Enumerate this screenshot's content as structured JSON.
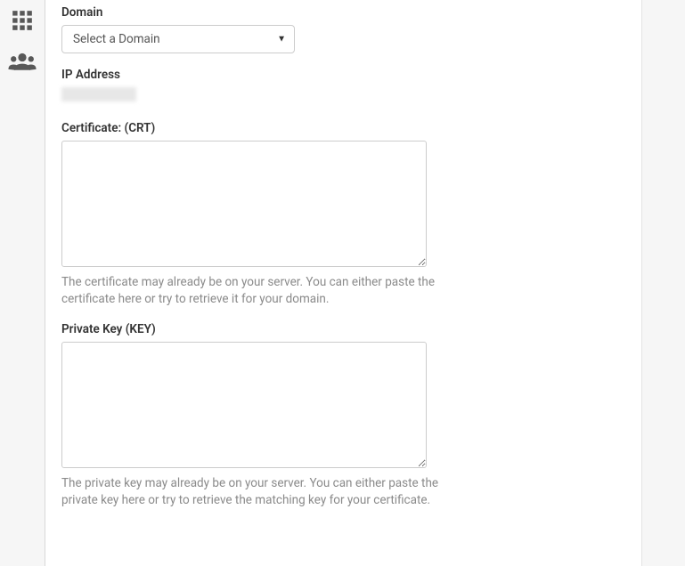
{
  "sidebar": {
    "grid_icon": "grid-icon",
    "users_icon": "users-icon"
  },
  "form": {
    "domain": {
      "label": "Domain",
      "placeholder": "Select a Domain"
    },
    "ip_address": {
      "label": "IP Address",
      "value": ""
    },
    "certificate": {
      "label": "Certificate: (CRT)",
      "value": "",
      "help": "The certificate may already be on your server. You can either paste the certificate here or try to retrieve it for your domain."
    },
    "private_key": {
      "label": "Private Key (KEY)",
      "value": "",
      "help": "The private key may already be on your server. You can either paste the private key here or try to retrieve the matching key for your certificate."
    }
  }
}
